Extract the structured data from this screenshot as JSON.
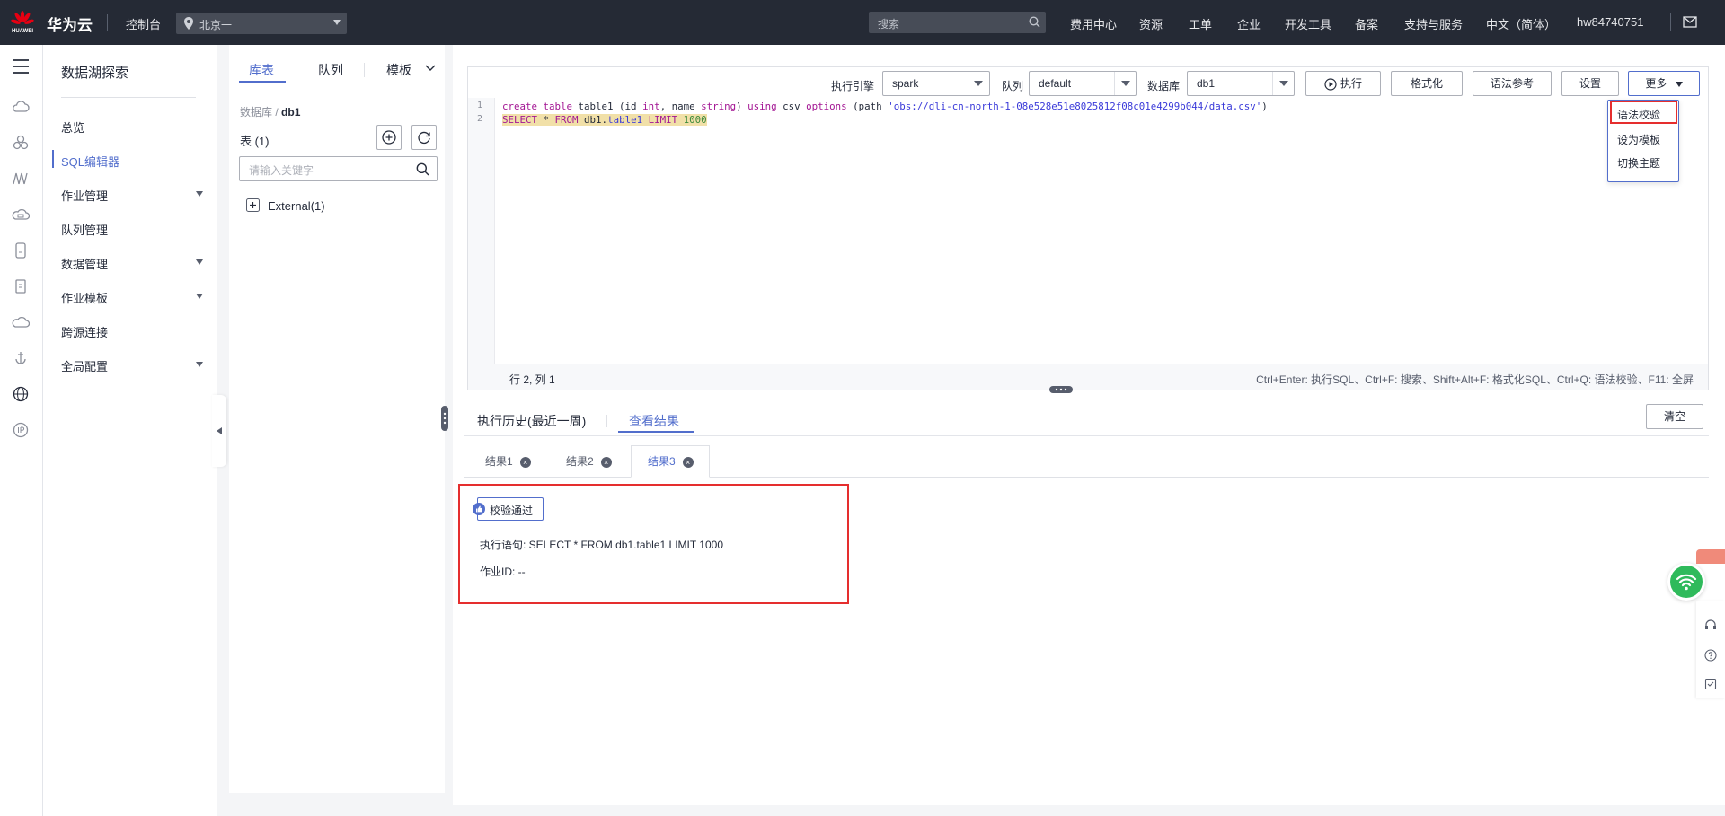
{
  "topbar": {
    "logo_text": "HUAWEI",
    "brand": "华为云",
    "console": "控制台",
    "region": "北京一",
    "search_placeholder": "搜索",
    "nav": [
      "费用中心",
      "资源",
      "工单",
      "企业",
      "开发工具",
      "备案",
      "支持与服务",
      "中文（简体）",
      "hw84740751"
    ]
  },
  "menu": {
    "title": "数据湖探索",
    "items": [
      {
        "label": "总览",
        "has_arrow": false
      },
      {
        "label": "SQL编辑器",
        "has_arrow": false,
        "active": true
      },
      {
        "label": "作业管理",
        "has_arrow": true
      },
      {
        "label": "队列管理",
        "has_arrow": false
      },
      {
        "label": "数据管理",
        "has_arrow": true
      },
      {
        "label": "作业模板",
        "has_arrow": true
      },
      {
        "label": "跨源连接",
        "has_arrow": false
      },
      {
        "label": "全局配置",
        "has_arrow": true
      }
    ]
  },
  "dbpanel": {
    "tabs": [
      "库表",
      "队列",
      "模板"
    ],
    "crumb_prefix": "数据库",
    "crumb_sep": "/",
    "crumb_db": "db1",
    "count": "表 (1)",
    "search_placeholder": "请输入关键字",
    "tree_node": "External(1)"
  },
  "toolbar": {
    "engine_label": "执行引擎",
    "engine_value": "spark",
    "queue_label": "队列",
    "queue_value": "default",
    "db_label": "数据库",
    "db_value": "db1",
    "run": "执行",
    "format": "格式化",
    "syntax_ref": "语法参考",
    "settings": "设置",
    "more": "更多"
  },
  "more_menu": [
    "语法校验",
    "设为模板",
    "切换主题"
  ],
  "editor": {
    "line_numbers": [
      "1",
      "2"
    ],
    "line1": {
      "kw1": "create",
      "kw2": "table",
      "t1": " table1 (id ",
      "kw3": "int",
      "t2": ", name ",
      "kw4": "string",
      "t3": ") ",
      "kw5": "using",
      "t4": " csv ",
      "kw6": "options",
      "t5": " (path ",
      "str": "'obs://dli-cn-north-1-08e528e51e8025812f08c01e4299b044/data.csv'",
      "t6": ")"
    },
    "line2": {
      "kw1": "SELECT",
      "t1": " * ",
      "kw2": "FROM",
      "t2": " db1.",
      "tbl": "table1",
      "sp": " ",
      "kw3": "LIMIT",
      "sp2": " ",
      "num": "1000"
    },
    "position": "行 2, 列 1",
    "shortcuts": "Ctrl+Enter: 执行SQL、Ctrl+F: 搜索、Shift+Alt+F: 格式化SQL、Ctrl+Q: 语法校验、F11: 全屏"
  },
  "results": {
    "tabs": [
      "执行历史(最近一周)",
      "查看结果"
    ],
    "clear": "清空",
    "subtabs": [
      "结果1",
      "结果2",
      "结果3"
    ],
    "close_glyph": "×",
    "status": "校验通过",
    "statement": "执行语句: SELECT * FROM db1.table1 LIMIT 1000",
    "job_id": "作业ID: --"
  },
  "colors": {
    "topbar_bg": "#252a35",
    "accent": "#526ecc",
    "highlight_box": "#e52e2e"
  }
}
